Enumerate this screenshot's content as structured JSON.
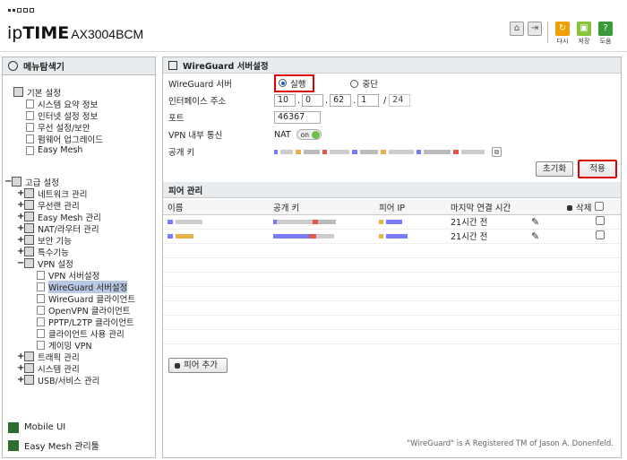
{
  "header": {
    "brand_prefix": "ip",
    "brand_main": "TIME",
    "model": "AX3004BCM",
    "icons": [
      "home-icon",
      "logout-icon"
    ],
    "buttons": [
      {
        "label": "다시",
        "icon": "refresh-icon",
        "color": "#f0a000"
      },
      {
        "label": "저장",
        "icon": "save-icon",
        "color": "#86c23a"
      },
      {
        "label": "도움",
        "icon": "help-icon",
        "color": "#3a9a3a"
      }
    ]
  },
  "sidebar": {
    "title": "메뉴탐색기",
    "basic": {
      "label": "기본 설정",
      "items": [
        "시스템 요약 정보",
        "인터넷 설정 정보",
        "무선 설정/보안",
        "펌웨어 업그레이드",
        "Easy Mesh"
      ]
    },
    "advanced": {
      "label": "고급 설정",
      "items": [
        "네트워크 관리",
        "무선랜 관리",
        "Easy Mesh 관리",
        "NAT/라우터 관리",
        "보안 기능",
        "특수기능"
      ],
      "vpn": {
        "label": "VPN 설정",
        "items": [
          "VPN 서버설정",
          "WireGuard 서버설정",
          "WireGuard 클라이언트",
          "OpenVPN 클라이언트",
          "PPTP/L2TP 클라이언트",
          "클라이언트 사용 관리",
          "게이밍 VPN"
        ]
      },
      "after": [
        "트래픽 관리",
        "시스템 관리",
        "USB/서비스 관리"
      ]
    },
    "links": [
      "Mobile UI",
      "Easy Mesh 관리툴"
    ]
  },
  "server": {
    "title": "WireGuard 서버설정",
    "server_label": "WireGuard 서버",
    "run_label": "실행",
    "stop_label": "중단",
    "iface_label": "인터페이스 주소",
    "ip": [
      "10",
      "0",
      "62",
      "1"
    ],
    "prefix": "24",
    "port_label": "포트",
    "port_value": "46367",
    "vpn_internal_label": "VPN 내부 통신",
    "nat_label": "NAT",
    "toggle_text": "on",
    "pubkey_label": "공개 키",
    "reset_button": "초기화",
    "apply_button": "적용"
  },
  "peers": {
    "title": "피어 관리",
    "columns": [
      "이름",
      "공개 키",
      "피어 IP",
      "마지막 연결 시간",
      "삭제"
    ],
    "rows": [
      {
        "last": "21시간 전"
      },
      {
        "last": "21시간 전"
      }
    ],
    "add_button": "피어 추가"
  },
  "footer": "\"WireGuard\" is A Registered TM of Jason A. Donenfeld."
}
